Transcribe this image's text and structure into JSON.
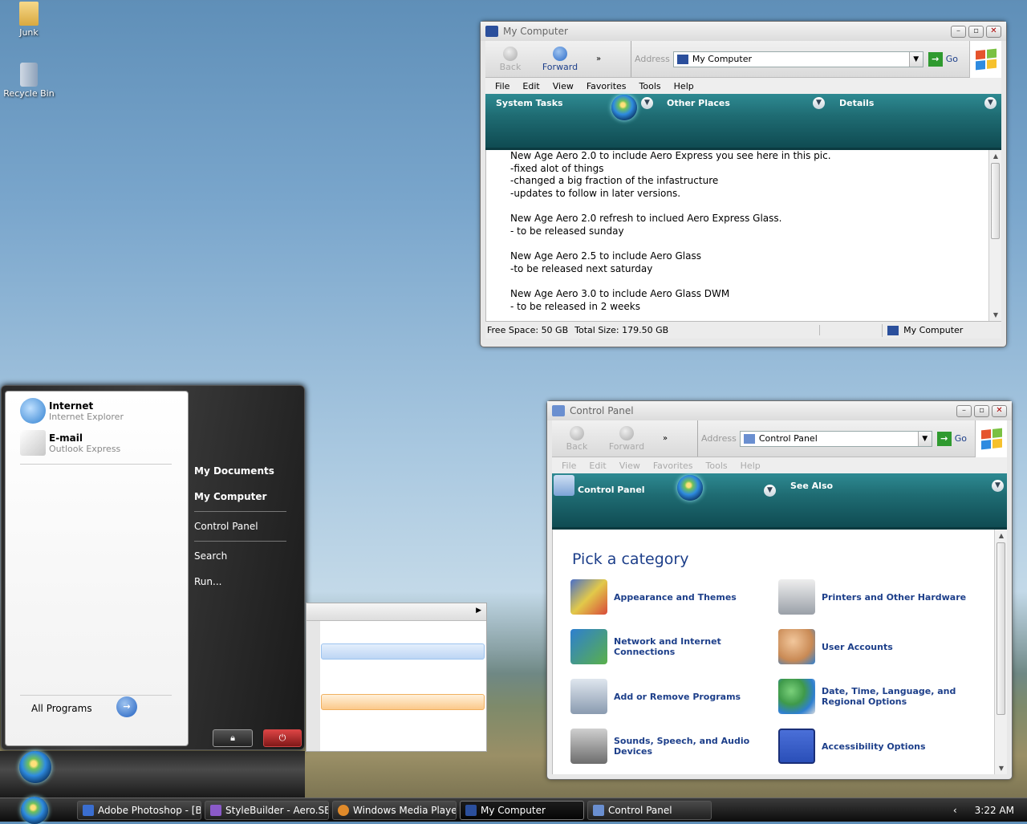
{
  "desktop": {
    "icons": [
      {
        "label": "Junk"
      },
      {
        "label": "Recycle Bin"
      }
    ]
  },
  "my_computer": {
    "title": "My Computer",
    "back": "Back",
    "forward": "Forward",
    "address_label": "Address",
    "address_value": "My Computer",
    "go": "Go",
    "menu": [
      "File",
      "Edit",
      "View",
      "Favorites",
      "Tools",
      "Help"
    ],
    "sections": [
      "System Tasks",
      "Other Places",
      "Details"
    ],
    "notes": [
      [
        "New Age Aero 2.0 to include Aero Express you see here in this pic.",
        "-fixed alot of things",
        "-changed a big fraction of the infastructure",
        "-updates to follow in later versions."
      ],
      [
        "New Age Aero 2.0 refresh to inclued Aero Express Glass.",
        "- to be released sunday"
      ],
      [
        "New Age Aero 2.5 to include Aero Glass",
        "-to be released next saturday"
      ],
      [
        "New Age Aero 3.0 to include Aero Glass DWM",
        "- to be released in 2 weeks"
      ]
    ],
    "status_free": "Free Space: 50 GB",
    "status_total": "Total Size: 179.50 GB",
    "status_loc": "My Computer"
  },
  "control_panel": {
    "title": "Control Panel",
    "back": "Back",
    "forward": "Forward",
    "address_label": "Address",
    "address_value": "Control Panel",
    "go": "Go",
    "menu": [
      "File",
      "Edit",
      "View",
      "Favorites",
      "Tools",
      "Help"
    ],
    "band_title": "Control Panel",
    "see_also": "See Also",
    "heading": "Pick a category",
    "categories": [
      {
        "label": "Appearance and Themes",
        "color": "#4a6fc8"
      },
      {
        "label": "Printers and Other Hardware",
        "color": "#9aa0a8"
      },
      {
        "label": "Network and Internet Connections",
        "color": "#2e7fd0"
      },
      {
        "label": "User Accounts",
        "color": "#c98a55"
      },
      {
        "label": "Add or Remove Programs",
        "color": "#8a9bb0"
      },
      {
        "label": "Date, Time, Language, and Regional Options",
        "color": "#3f9a4a"
      },
      {
        "label": "Sounds, Speech, and Audio Devices",
        "color": "#6d6d6d"
      },
      {
        "label": "Accessibility Options",
        "color": "#2a4fb8"
      }
    ]
  },
  "start_menu": {
    "pinned": [
      {
        "title": "Internet",
        "sub": "Internet Explorer",
        "color": "#2e7fd0"
      },
      {
        "title": "E-mail",
        "sub": "Outlook Express",
        "color": "#c8c8c8"
      }
    ],
    "right": [
      "My Documents",
      "My Computer",
      "Control Panel",
      "Search",
      "Run..."
    ],
    "all_programs": "All Programs"
  },
  "taskbar": {
    "buttons": [
      {
        "label": "Adobe Photoshop - [Bit...",
        "color": "#3a6ed0"
      },
      {
        "label": "StyleBuilder - Aero.SB -",
        "color": "#8a5ac8"
      },
      {
        "label": "Windows Media Player",
        "color": "#e08a2a"
      },
      {
        "label": "My Computer",
        "color": "#2b4f9c"
      },
      {
        "label": "Control Panel",
        "color": "#6a8fd0"
      }
    ],
    "active_index": 3,
    "clock": "3:22 AM"
  }
}
